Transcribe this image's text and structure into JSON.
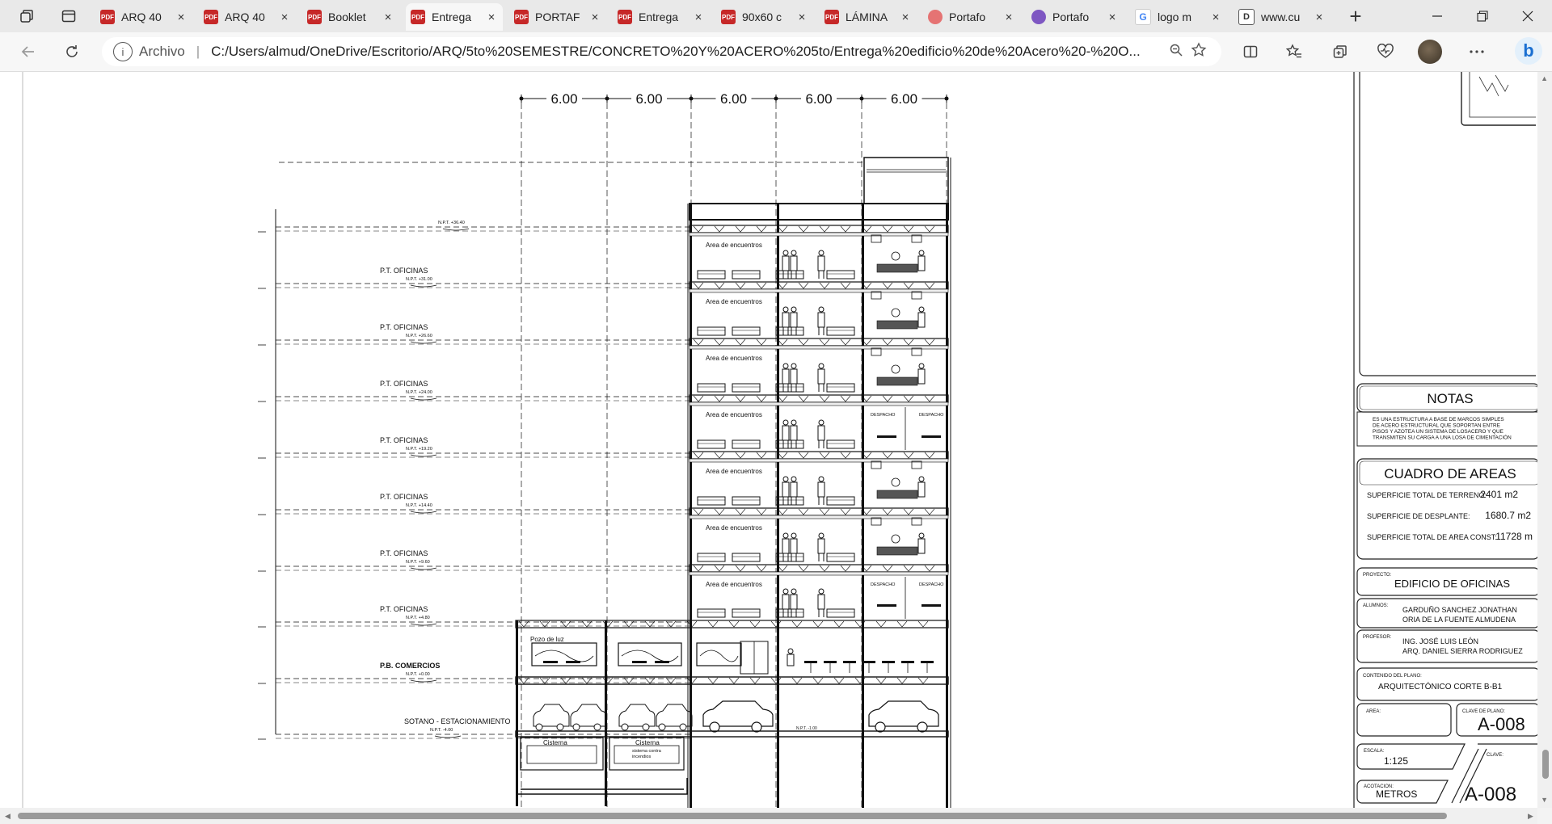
{
  "browser": {
    "tabs": [
      {
        "label": "ARQ 40",
        "icon": "pdf"
      },
      {
        "label": "ARQ 40",
        "icon": "pdf"
      },
      {
        "label": "Booklet",
        "icon": "pdf"
      },
      {
        "label": "Entrega",
        "icon": "pdf",
        "active": true
      },
      {
        "label": "PORTAF",
        "icon": "pdf"
      },
      {
        "label": "Entrega",
        "icon": "pdf"
      },
      {
        "label": "90x60 c",
        "icon": "pdf"
      },
      {
        "label": "LÁMINA",
        "icon": "pdf"
      },
      {
        "label": "Portafo",
        "icon": "portfolio"
      },
      {
        "label": "Portafo",
        "icon": "canva"
      },
      {
        "label": "logo m",
        "icon": "google"
      },
      {
        "label": "www.cu",
        "icon": "web"
      }
    ],
    "pdf_icon_text": "PDF",
    "google_icon_text": "G",
    "web_icon_text": "D",
    "new_tab": "+",
    "close_glyph": "×",
    "address": {
      "scheme_label": "Archivo",
      "separator": "|",
      "url": "C:/Users/almud/OneDrive/Escritorio/ARQ/5to%20SEMESTRE/CONCRETO%20Y%20ACERO%205to/Entrega%20edificio%20de%20Acero%20-%20O..."
    },
    "bing_label": "b"
  },
  "drawing": {
    "bay_dimensions": [
      "6.00",
      "6.00",
      "6.00",
      "6.00",
      "6.00"
    ],
    "levels": [
      {
        "label": "",
        "npt": "N.P.T. +36.40"
      },
      {
        "label": "P.T. OFICINAS",
        "npt": "N.P.T. +31.00"
      },
      {
        "label": "P.T. OFICINAS",
        "npt": "N.P.T. +26.60"
      },
      {
        "label": "P.T. OFICINAS",
        "npt": "N.P.T. +24.00"
      },
      {
        "label": "P.T. OFICINAS",
        "npt": "N.P.T. +19.20"
      },
      {
        "label": "P.T. OFICINAS",
        "npt": "N.P.T. +14.40"
      },
      {
        "label": "P.T. OFICINAS",
        "npt": "N.P.T. +9.60"
      },
      {
        "label": "P.T. OFICINAS",
        "npt": "N.P.T. +4.80"
      },
      {
        "label": "P.B. COMERCIOS",
        "npt": "N.P.T. +0.00"
      },
      {
        "label": "SOTANO - ESTACIONAMIENTO",
        "npt": "N.P.T. -4.00"
      }
    ],
    "room_label": "Area de encuentros",
    "office_label": "DESPACHO",
    "pozo_label": "Pozo de luz",
    "cisterna_label": "Cisterna",
    "cisterna2_label": "Cisterna",
    "cisterna2_sub1": "sistema contra",
    "cisterna2_sub2": "incendios",
    "basement_npt": "N.P.T. -1.00"
  },
  "title_block": {
    "notes_title": "NOTAS",
    "notes_lines": [
      "ES UNA ESTRUCTURA A BASE DE MARCOS SIMPLES",
      "DE ACERO ESTRUCTURAL QUE SOPORTAN ENTRE",
      "PISOS Y AZOTEA UN SISTEMA DE LOSACERO Y QUE",
      "TRANSMITEN SU CARGA A UNA LOSA DE CIMENTACIÓN"
    ],
    "areas_title": "CUADRO DE AREAS",
    "areas": [
      {
        "label": "SUPERFICIE TOTAL DE TERRENO:",
        "value": "2401 m2"
      },
      {
        "label": "SUPERFICIE DE DESPLANTE:",
        "value": "1680.7 m2"
      },
      {
        "label": "SUPERFICIE TOTAL DE AREA CONST:",
        "value": "11728 m"
      }
    ],
    "proyecto_label": "PROYECTO:",
    "proyecto": "EDIFICIO DE OFICINAS",
    "alumnos_label": "ALUMNOS:",
    "alumnos": [
      "GARDUÑO SANCHEZ JONATHAN",
      "ORIA DE LA FUENTE ALMUDENA"
    ],
    "profesor_label": "PROFESOR:",
    "profesores": [
      "ING. JOSÉ LUIS LEÓN",
      "ARQ. DANIEL SIERRA RODRIGUEZ"
    ],
    "contenido_label": "CONTENIDO DEL PLANO:",
    "contenido": "ARQUITECTÓNICO CORTE B-B1",
    "area_label": "AREA:",
    "clave_plano_label": "CLAVE DE PLANO:",
    "clave_plano": "A-008",
    "escala_label": "ESCALA:",
    "escala": "1:125",
    "clave_label": "CLAVE:",
    "acotacion_label": "ACOTACION:",
    "acotacion": "METROS",
    "clave_big": "A-008"
  }
}
